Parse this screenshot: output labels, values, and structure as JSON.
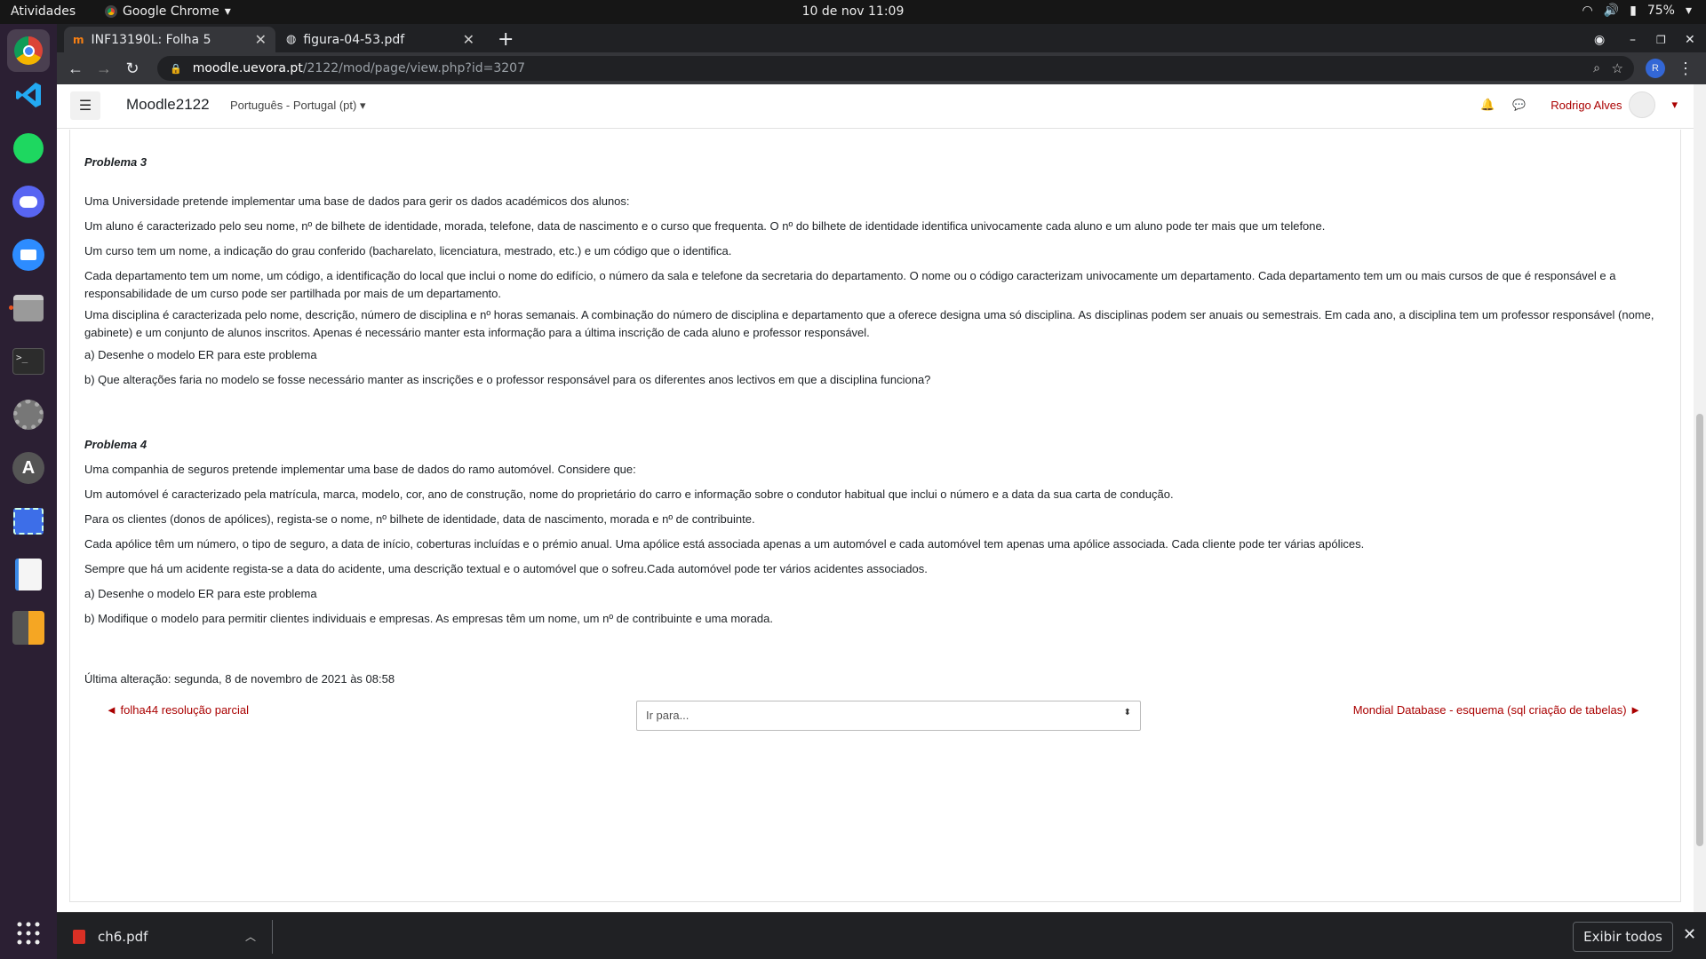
{
  "topbar": {
    "activities": "Atividades",
    "app_name": "Google Chrome",
    "clock": "10 de nov  11:09",
    "battery": "75%"
  },
  "dock": {
    "items": [
      "chrome-icon",
      "vscode-icon",
      "spotify-icon",
      "discord-icon",
      "zoom-icon",
      "files-icon",
      "terminal-icon",
      "settings-icon",
      "software-icon",
      "screenshot-icon",
      "text-editor-icon",
      "calculator-icon",
      "app-grid-icon"
    ]
  },
  "browser": {
    "tabs": [
      {
        "label": "INF13190L: Folha 5",
        "favicon": "moodle-icon"
      },
      {
        "label": "figura-04-53.pdf",
        "favicon": "globe-icon"
      }
    ],
    "url_host": "moodle.uevora.pt",
    "url_path": "/2122/mod/page/view.php?id=3207",
    "profile_initial": "R"
  },
  "navbar": {
    "site_name": "Moodle2122",
    "language": "Português - Portugal (pt)",
    "user_name": "Rodrigo Alves"
  },
  "content": {
    "p3_title": "Problema 3",
    "p3_1": "Uma Universidade pretende implementar uma base de dados para gerir os dados académicos dos alunos:",
    "p3_2": "Um aluno é caracterizado pelo seu nome, nº de bilhete de identidade, morada, telefone, data de nascimento e o curso que frequenta. O nº do bilhete de identidade identifica univocamente cada aluno e um aluno pode ter mais que um telefone.",
    "p3_3": "Um curso tem um nome, a indicação do grau conferido (bacharelato, licenciatura, mestrado, etc.) e  um código que o identifica.",
    "p3_4": "Cada departamento tem um nome, um código, a identificação do local que inclui o nome do edifício, o número da sala e telefone da secretaria do departamento. O nome ou o código caracterizam univocamente um departamento. Cada departamento tem um ou mais cursos de que é responsável e a responsabilidade de um curso pode ser partilhada por mais de um departamento.",
    "p3_5": "Uma disciplina é caracterizada pelo nome, descrição, número de disciplina e nº horas semanais. A combinação do número de disciplina e departamento que a oferece designa uma só disciplina. As disciplinas podem ser anuais ou semestrais. Em cada ano, a disciplina tem um professor responsável (nome, gabinete) e um conjunto de alunos inscritos. Apenas é necessário manter esta informação para a última inscrição de cada aluno e professor responsável.",
    "p3_a": "a) Desenhe o modelo ER para este problema",
    "p3_b": "b) Que alterações faria no modelo se fosse necessário manter as inscrições e o professor responsável para os diferentes anos lectivos em que a disciplina funciona?",
    "p4_title": "Problema 4",
    "p4_1": "Uma companhia de seguros pretende implementar uma base de dados do ramo automóvel. Considere que:",
    "p4_2": "Um automóvel é caracterizado pela matrícula, marca, modelo,  cor,  ano de construção,  nome do proprietário do carro e  informação sobre  o condutor habitual que inclui o número e a data da sua carta de condução.",
    "p4_3": "Para os clientes (donos de apólices),  regista-se o nome, nº bilhete de identidade, data de nascimento, morada e nº de contribuinte.",
    "p4_4": "Cada apólice têm um número, o tipo de seguro, a data de início,  coberturas incluídas e o prémio anual. Uma apólice está associada apenas a um automóvel e cada automóvel tem apenas uma apólice associada. Cada cliente pode ter várias apólices.",
    "p4_5": "Sempre que há um acidente regista-se  a data do acidente, uma descrição textual e o automóvel que o sofreu.Cada automóvel pode ter vários acidentes associados.",
    "p4_a": "a) Desenhe o modelo ER para este problema",
    "p4_b": "b) Modifique o modelo para permitir clientes individuais e empresas. As empresas têm um nome, um nº de contribuinte e uma morada.",
    "last_modified": "Última alteração: segunda, 8 de novembro de 2021 às 08:58"
  },
  "footer_nav": {
    "prev": "◄ folha44 resolução parcial",
    "jump": "Ir para...",
    "next": "Mondial Database - esquema (sql criação de tabelas) ►"
  },
  "downloads": {
    "file": "ch6.pdf",
    "show_all": "Exibir todos"
  }
}
